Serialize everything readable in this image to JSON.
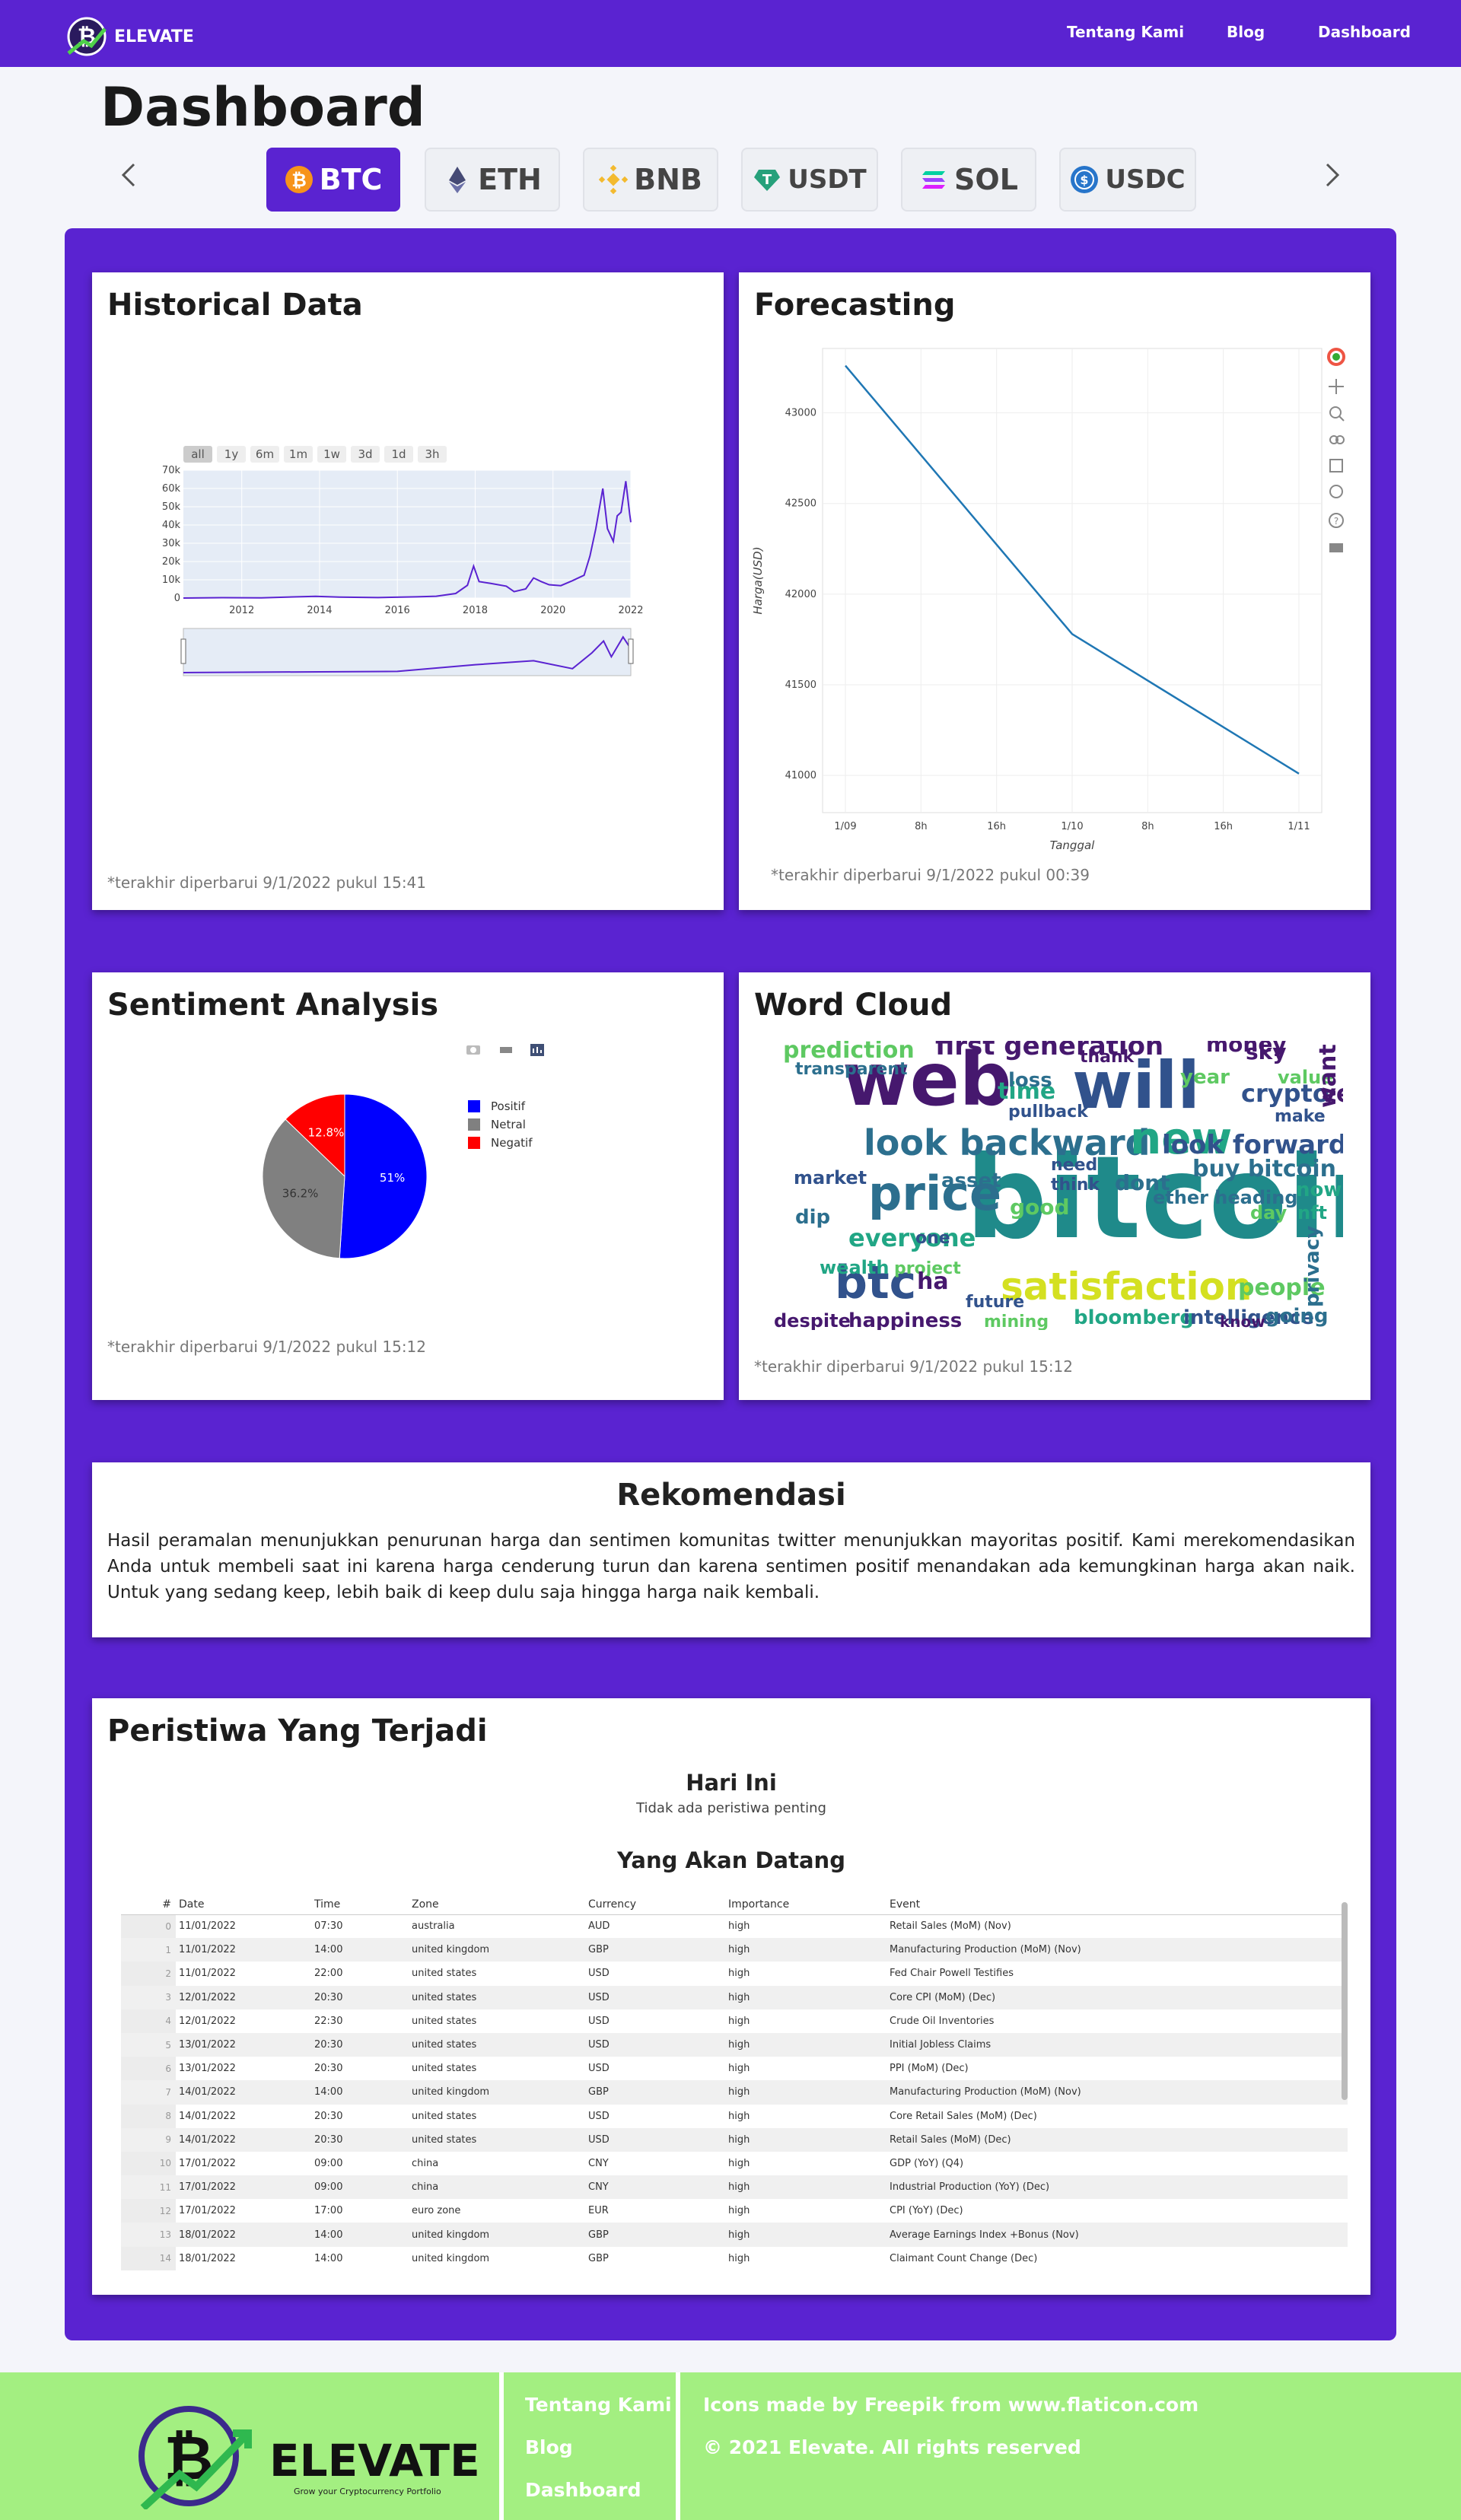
{
  "nav": {
    "brand": "ELEVATE",
    "links": [
      "Tentang Kami",
      "Blog",
      "Dashboard"
    ]
  },
  "page": {
    "title": "Dashboard"
  },
  "coins": [
    {
      "label": "BTC",
      "icon": "bitcoin-icon",
      "color": "#f7931a",
      "active": true
    },
    {
      "label": "ETH",
      "icon": "ethereum-icon",
      "color": "#454a75",
      "active": false
    },
    {
      "label": "BNB",
      "icon": "binance-icon",
      "color": "#f3ba2f",
      "active": false
    },
    {
      "label": "USDT",
      "icon": "tether-icon",
      "color": "#26a17b",
      "active": false
    },
    {
      "label": "SOL",
      "icon": "solana-icon",
      "color": "#9945ff",
      "active": false
    },
    {
      "label": "USDC",
      "icon": "usdc-icon",
      "color": "#2775ca",
      "active": false
    }
  ],
  "historical": {
    "title": "Historical Data",
    "range_buttons": [
      "all",
      "1y",
      "6m",
      "1m",
      "1w",
      "3d",
      "1d",
      "3h"
    ],
    "note": "*terakhir diperbarui 9/1/2022 pukul 15:41"
  },
  "forecasting": {
    "title": "Forecasting",
    "note": "*terakhir diperbarui 9/1/2022 pukul 00:39"
  },
  "sentiment": {
    "title": "Sentiment Analysis",
    "note": "*terakhir diperbarui 9/1/2022 pukul 15:12"
  },
  "wordcloud": {
    "title": "Word Cloud",
    "note": "*terakhir diperbarui 9/1/2022 pukul 15:12",
    "words": [
      {
        "t": "bitcoin",
        "c": "#1f8a8a"
      },
      {
        "t": "web",
        "c": "#46186e"
      },
      {
        "t": "will",
        "c": "#31528c"
      },
      {
        "t": "price",
        "c": "#2c6f8e"
      },
      {
        "t": "satisfaction",
        "c": "#d4e021"
      },
      {
        "t": "look backward",
        "c": "#2c6f8e"
      },
      {
        "t": "new",
        "c": "#21a685"
      },
      {
        "t": "btc",
        "c": "#31528c"
      },
      {
        "t": "first generation",
        "c": "#46186e"
      },
      {
        "t": "look forward",
        "c": "#31528c"
      },
      {
        "t": "prediction",
        "c": "#5ec962"
      },
      {
        "t": "everyone",
        "c": "#21a685"
      },
      {
        "t": "crypto",
        "c": "#31528c"
      },
      {
        "t": "buy bitcoin",
        "c": "#2c6f8e"
      },
      {
        "t": "happiness",
        "c": "#46186e"
      },
      {
        "t": "bloomberg",
        "c": "#21a685"
      },
      {
        "t": "intelligence",
        "c": "#31528c"
      },
      {
        "t": "people",
        "c": "#5ec962"
      },
      {
        "t": "money",
        "c": "#46186e"
      },
      {
        "t": "sky",
        "c": "#46186e"
      },
      {
        "t": "year",
        "c": "#5ec962"
      },
      {
        "t": "time",
        "c": "#21a685"
      },
      {
        "t": "market",
        "c": "#31528c"
      },
      {
        "t": "asset",
        "c": "#2c6f8e"
      },
      {
        "t": "ether heading",
        "c": "#2c6f8e"
      },
      {
        "t": "despite",
        "c": "#46186e"
      },
      {
        "t": "mining",
        "c": "#5ec962"
      },
      {
        "t": "future",
        "c": "#31528c"
      },
      {
        "t": "going",
        "c": "#2c6f8e"
      },
      {
        "t": "know",
        "c": "#46186e"
      },
      {
        "t": "value",
        "c": "#5ec962"
      },
      {
        "t": "think",
        "c": "#31528c"
      },
      {
        "t": "dont",
        "c": "#2c6f8e"
      },
      {
        "t": "wealth",
        "c": "#21a685"
      },
      {
        "t": "project",
        "c": "#5ec962"
      },
      {
        "t": "good",
        "c": "#5ec962"
      },
      {
        "t": "need",
        "c": "#31528c"
      },
      {
        "t": "now",
        "c": "#21a685"
      },
      {
        "t": "make",
        "c": "#31528c"
      },
      {
        "t": "day",
        "c": "#5ec962"
      },
      {
        "t": "nft",
        "c": "#21a685"
      },
      {
        "t": "privacy",
        "c": "#2c6f8e"
      },
      {
        "t": "transparent",
        "c": "#2c6f8e"
      },
      {
        "t": "pullback",
        "c": "#31528c"
      },
      {
        "t": "thank",
        "c": "#46186e"
      },
      {
        "t": "loss",
        "c": "#2c6f8e"
      },
      {
        "t": "want",
        "c": "#46186e"
      },
      {
        "t": "ve",
        "c": "#46186e"
      },
      {
        "t": "dip",
        "c": "#2c6f8e"
      },
      {
        "t": "one",
        "c": "#31528c"
      },
      {
        "t": "ha",
        "c": "#46186e"
      }
    ]
  },
  "recommendation": {
    "title": "Rekomendasi",
    "text": "Hasil peramalan menunjukkan penurunan harga dan sentimen komunitas twitter menunjukkan mayoritas positif. Kami merekomendasikan Anda untuk membeli saat ini karena harga cenderung turun dan karena sentimen positif menandakan ada kemungkinan harga akan naik. Untuk yang sedang keep, lebih baik di keep dulu saja hingga harga naik kembali."
  },
  "events": {
    "title": "Peristiwa Yang Terjadi",
    "today_title": "Hari Ini",
    "today_text": "Tidak ada peristiwa penting",
    "upcoming_title": "Yang Akan Datang",
    "columns": [
      "#",
      "Date",
      "Time",
      "Zone",
      "Currency",
      "Importance",
      "Event"
    ],
    "rows": [
      [
        "0",
        "11/01/2022",
        "07:30",
        "australia",
        "AUD",
        "high",
        "Retail Sales (MoM) (Nov)"
      ],
      [
        "1",
        "11/01/2022",
        "14:00",
        "united kingdom",
        "GBP",
        "high",
        "Manufacturing Production (MoM) (Nov)"
      ],
      [
        "2",
        "11/01/2022",
        "22:00",
        "united states",
        "USD",
        "high",
        "Fed Chair Powell Testifies"
      ],
      [
        "3",
        "12/01/2022",
        "20:30",
        "united states",
        "USD",
        "high",
        "Core CPI (MoM) (Dec)"
      ],
      [
        "4",
        "12/01/2022",
        "22:30",
        "united states",
        "USD",
        "high",
        "Crude Oil Inventories"
      ],
      [
        "5",
        "13/01/2022",
        "20:30",
        "united states",
        "USD",
        "high",
        "Initial Jobless Claims"
      ],
      [
        "6",
        "13/01/2022",
        "20:30",
        "united states",
        "USD",
        "high",
        "PPI (MoM) (Dec)"
      ],
      [
        "7",
        "14/01/2022",
        "14:00",
        "united kingdom",
        "GBP",
        "high",
        "Manufacturing Production (MoM) (Nov)"
      ],
      [
        "8",
        "14/01/2022",
        "20:30",
        "united states",
        "USD",
        "high",
        "Core Retail Sales (MoM) (Dec)"
      ],
      [
        "9",
        "14/01/2022",
        "20:30",
        "united states",
        "USD",
        "high",
        "Retail Sales (MoM) (Dec)"
      ],
      [
        "10",
        "17/01/2022",
        "09:00",
        "china",
        "CNY",
        "high",
        "GDP (YoY) (Q4)"
      ],
      [
        "11",
        "17/01/2022",
        "09:00",
        "china",
        "CNY",
        "high",
        "Industrial Production (YoY) (Dec)"
      ],
      [
        "12",
        "17/01/2022",
        "17:00",
        "euro zone",
        "EUR",
        "high",
        "CPI (YoY) (Dec)"
      ],
      [
        "13",
        "18/01/2022",
        "14:00",
        "united kingdom",
        "GBP",
        "high",
        "Average Earnings Index +Bonus (Nov)"
      ],
      [
        "14",
        "18/01/2022",
        "14:00",
        "united kingdom",
        "GBP",
        "high",
        "Claimant Count Change (Dec)"
      ]
    ]
  },
  "footer": {
    "brand": "ELEVATE",
    "tagline": "Grow your Cryptocurrency Portfolio",
    "links": [
      "Tentang Kami",
      "Blog",
      "Dashboard"
    ],
    "credit": "Icons made by Freepik from www.flaticon.com",
    "copyright": "© 2021 Elevate. All rights reserved"
  },
  "chart_data": [
    {
      "type": "line",
      "title": "",
      "xlabel": "",
      "ylabel": "",
      "xlim": [
        2010.5,
        2022.0
      ],
      "ylim": [
        0,
        70000
      ],
      "x_ticks": [
        "2012",
        "2014",
        "2016",
        "2018",
        "2020",
        "2022"
      ],
      "y_ticks": [
        "0",
        "10k",
        "20k",
        "30k",
        "40k",
        "50k",
        "60k",
        "70k"
      ],
      "color": "#5a23d1",
      "grid": true,
      "x": [
        2010.5,
        2011.5,
        2012.5,
        2013.0,
        2013.9,
        2014.5,
        2015.5,
        2016.5,
        2017.0,
        2017.5,
        2017.8,
        2017.96,
        2018.1,
        2018.4,
        2018.8,
        2019.0,
        2019.3,
        2019.5,
        2019.7,
        2019.9,
        2020.2,
        2020.5,
        2020.8,
        2020.95,
        2021.1,
        2021.28,
        2021.4,
        2021.55,
        2021.65,
        2021.75,
        2021.87,
        2021.97,
        2022.0
      ],
      "y": [
        0,
        200,
        100,
        400,
        900,
        500,
        250,
        650,
        1000,
        2500,
        7000,
        17500,
        9000,
        8000,
        6500,
        3500,
        5000,
        11000,
        9000,
        7300,
        6800,
        9500,
        12500,
        23000,
        38000,
        60000,
        38000,
        31000,
        45000,
        47000,
        64000,
        46000,
        41500
      ],
      "range_selector": {
        "x": [
          2010.5,
          2012,
          2014,
          2016,
          2018,
          2019.5,
          2020.5,
          2021.0,
          2021.3,
          2021.5,
          2021.8,
          2022.0
        ],
        "y": [
          0,
          0.1,
          0.2,
          0.3,
          2,
          3,
          1,
          5,
          8,
          4,
          9,
          6
        ]
      }
    },
    {
      "type": "line",
      "title": "",
      "xlabel": "Tanggal",
      "ylabel": "Harga(USD)",
      "x_ticks": [
        "1/09",
        "8h",
        "16h",
        "1/10",
        "8h",
        "16h",
        "1/11"
      ],
      "y_ticks": [
        "41000",
        "41500",
        "42000",
        "42500",
        "43000"
      ],
      "ylim": [
        40900,
        43250
      ],
      "color": "#1f77b4",
      "grid": true,
      "x": [
        "1/09",
        "1/10",
        "1/11"
      ],
      "y": [
        43260,
        41780,
        41010
      ]
    },
    {
      "type": "pie",
      "title": "",
      "labels": [
        "Positif",
        "Netral",
        "Negatif"
      ],
      "values": [
        51.0,
        36.2,
        12.8
      ],
      "colors": [
        "#0000ff",
        "#808080",
        "#ff0000"
      ],
      "legend": "right"
    }
  ]
}
